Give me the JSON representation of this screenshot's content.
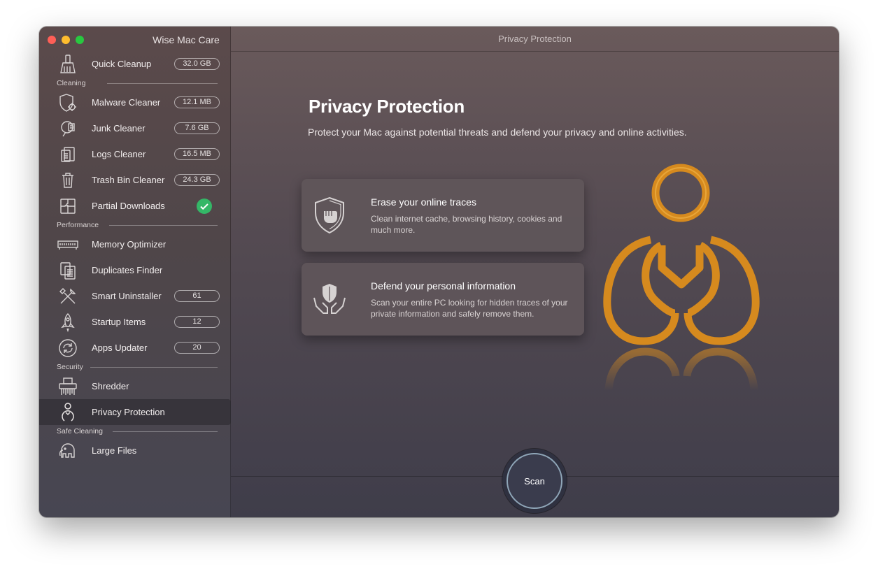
{
  "app": {
    "title": "Wise Mac Care"
  },
  "window": {
    "title": "Privacy Protection"
  },
  "sidebar": {
    "top_item": {
      "label": "Quick Cleanup",
      "badge": "32.0 GB"
    },
    "sections": {
      "cleaning": "Cleaning",
      "performance": "Performance",
      "security": "Security",
      "safe_cleaning": "Safe Cleaning"
    },
    "items": [
      {
        "label": "Malware Cleaner",
        "badge": "12.1 MB",
        "icon": "malware-icon"
      },
      {
        "label": "Junk Cleaner",
        "badge": "7.6 GB",
        "icon": "junk-icon"
      },
      {
        "label": "Logs Cleaner",
        "badge": "16.5 MB",
        "icon": "logs-icon"
      },
      {
        "label": "Trash Bin Cleaner",
        "badge": "24.3 GB",
        "icon": "trash-icon"
      },
      {
        "label": "Partial Downloads",
        "status": "done",
        "icon": "puzzle-icon"
      },
      {
        "label": "Memory Optimizer",
        "icon": "memory-icon"
      },
      {
        "label": "Duplicates Finder",
        "icon": "duplicates-icon"
      },
      {
        "label": "Smart Uninstaller",
        "badge": "61",
        "icon": "tools-icon"
      },
      {
        "label": "Startup Items",
        "badge": "12",
        "icon": "rocket-icon"
      },
      {
        "label": "Apps Updater",
        "badge": "20",
        "icon": "update-icon"
      },
      {
        "label": "Shredder",
        "icon": "shredder-icon"
      },
      {
        "label": "Privacy Protection",
        "active": true,
        "icon": "privacy-icon"
      },
      {
        "label": "Large Files",
        "icon": "elephant-icon"
      }
    ]
  },
  "main": {
    "title": "Privacy Protection",
    "subtitle": "Protect your Mac against potential threats and defend your privacy and online activities.",
    "cards": [
      {
        "title": "Erase your online traces",
        "description": "Clean internet cache, browsing history, cookies and much more.",
        "icon": "shield-fist-icon"
      },
      {
        "title": "Defend your personal information",
        "description": "Scan your entire PC looking for hidden traces of your private information and safely remove them.",
        "icon": "hands-shield-icon"
      }
    ],
    "scan_label": "Scan"
  },
  "colors": {
    "accent_orange": "#d68a1e",
    "check_green": "#34b767",
    "scan_ring": "#8fa6b8"
  }
}
